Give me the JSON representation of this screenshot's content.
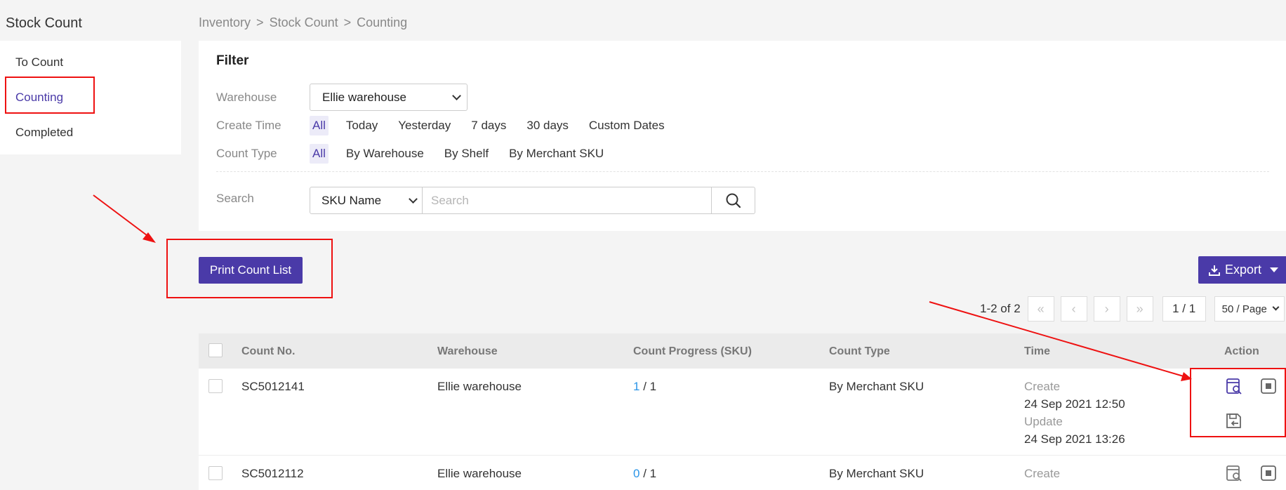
{
  "sidebar": {
    "title": "Stock Count",
    "items": [
      {
        "label": "To Count",
        "active": false
      },
      {
        "label": "Counting",
        "active": true
      },
      {
        "label": "Completed",
        "active": false
      }
    ]
  },
  "breadcrumb": [
    "Inventory",
    "Stock Count",
    "Counting"
  ],
  "filter": {
    "title": "Filter",
    "warehouse_label": "Warehouse",
    "warehouse_value": "Ellie warehouse",
    "create_time_label": "Create Time",
    "create_time_options": [
      "All",
      "Today",
      "Yesterday",
      "7 days",
      "30 days",
      "Custom Dates"
    ],
    "count_type_label": "Count Type",
    "count_type_options": [
      "All",
      "By Warehouse",
      "By Shelf",
      "By Merchant SKU"
    ],
    "search_label": "Search",
    "search_type": "SKU Name",
    "search_placeholder": "Search"
  },
  "actions": {
    "print_label": "Print Count List",
    "export_label": "Export"
  },
  "pagination": {
    "info": "1-2 of 2",
    "page": "1 / 1",
    "page_size": "50 / Page"
  },
  "table": {
    "columns": [
      "Count No.",
      "Warehouse",
      "Count Progress (SKU)",
      "Count Type",
      "Time",
      "Action"
    ],
    "rows": [
      {
        "count_no": "SC5012141",
        "warehouse": "Ellie warehouse",
        "progress_done": "1",
        "progress_total": "/ 1",
        "count_type": "By Merchant SKU",
        "create_label": "Create",
        "create_time": "24 Sep 2021 12:50",
        "update_label": "Update",
        "update_time": "24 Sep 2021 13:26"
      },
      {
        "count_no": "SC5012112",
        "warehouse": "Ellie warehouse",
        "progress_done": "0",
        "progress_total": "/ 1",
        "count_type": "By Merchant SKU",
        "create_label": "Create"
      }
    ]
  },
  "colors": {
    "accent": "#4a3aa8",
    "progress": "#2a95e8",
    "annotation": "#ee1111"
  }
}
